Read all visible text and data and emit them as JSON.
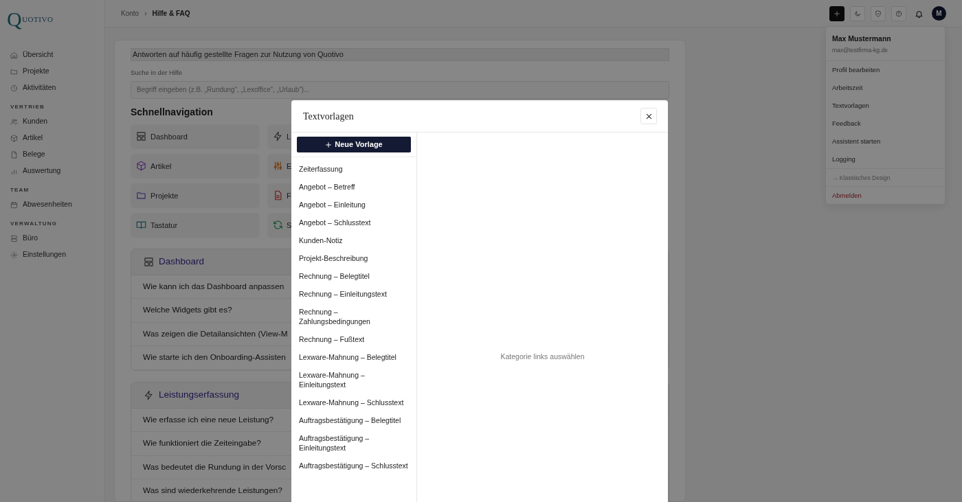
{
  "logo": {
    "text": "QUOTIVO"
  },
  "sidebar": {
    "sections": [
      {
        "items": [
          "Übersicht",
          "Projekte",
          "Aktivitäten"
        ]
      },
      {
        "heading": "VERTRIEB",
        "items": [
          "Kunden",
          "Artikel",
          "Belege",
          "Auswertung"
        ]
      },
      {
        "heading": "TEAM",
        "items": [
          "Abwesenheiten"
        ]
      },
      {
        "heading": "VERWALTUNG",
        "items": [
          "Büro",
          "Einstellungen"
        ]
      }
    ]
  },
  "breadcrumb": {
    "items": [
      "Konto",
      "Hilfe & FAQ"
    ],
    "separator": "›"
  },
  "topbar": {
    "avatar": "M"
  },
  "account_menu": {
    "name": "Max Mustermann",
    "email": "max@testfirma-kg.de",
    "items": [
      {
        "label": "Profil bearbeiten",
        "kind": "normal"
      },
      {
        "label": "Arbeitszeit",
        "kind": "normal"
      },
      {
        "label": "Textvorlagen",
        "kind": "normal"
      },
      {
        "label": "Feedback",
        "kind": "normal"
      },
      {
        "label": "Assistent starten",
        "kind": "normal"
      },
      {
        "label": "Logging",
        "kind": "normal"
      },
      {
        "label": "→ Klassisches Design",
        "kind": "muted"
      },
      {
        "label": "Abmelden",
        "kind": "danger"
      }
    ]
  },
  "help": {
    "intro": "Antworten auf häufig gestellte Fragen zur Nutzung von Quotivo",
    "search_label": "Suche in der Hilfe",
    "search": {
      "placeholder": "Begriff eingeben (z.B. „Rundung“, „Lexoffice“, „Urlaub“)..."
    },
    "quicknav_title": "Schnellnavigation",
    "quicknav": [
      "Dashboard",
      "L",
      "Artikel",
      "E",
      "Projekte",
      "F",
      "Tastatur",
      "S"
    ],
    "faq_sections": [
      {
        "title": "Dashboard",
        "questions": [
          "Wie kann ich das Dashboard anpassen",
          "Welche Widgets gibt es?",
          "Was zeigen die Detailansichten (View-M",
          "Wie starte ich den Onboarding-Assisten"
        ]
      },
      {
        "title": "Leistungserfassung",
        "questions": [
          "Wie erfasse ich eine neue Leistung?",
          "Wie funktioniert die Zeiteingabe?",
          "Was bedeutet die Rundung in der Vorsc",
          "Was sind wiederkehrende Leistungen?"
        ]
      }
    ]
  },
  "modal": {
    "title": "Textvorlagen",
    "new_button": "Neue Vorlage",
    "templates": [
      "Zeiterfassung",
      "Angebot – Betreff",
      "Angebot – Einleitung",
      "Angebot – Schlusstext",
      "Kunden-Notiz",
      "Projekt-Beschreibung",
      "Rechnung – Belegtitel",
      "Rechnung – Einleitungstext",
      "Rechnung – Zahlungsbedingungen",
      "Rechnung – Fußtext",
      "Lexware-Mahnung – Belegtitel",
      "Lexware-Mahnung – Einleitungstext",
      "Lexware-Mahnung – Schlusstext",
      "Auftragsbestätigung – Belegtitel",
      "Auftragsbestätigung – Einleitungstext",
      "Auftragsbestätigung – Schlusstext"
    ],
    "empty_hint": "Kategorie links auswählen"
  }
}
